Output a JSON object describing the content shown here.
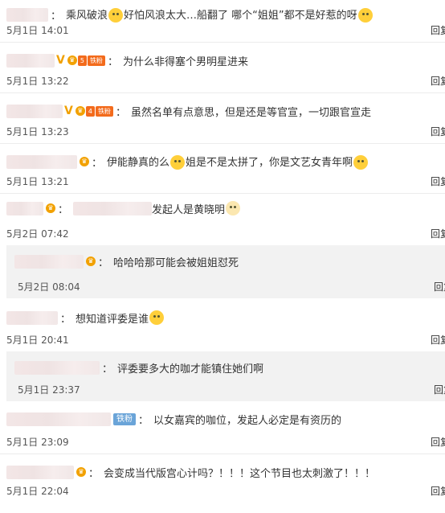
{
  "comments": [
    {
      "user_width": 52,
      "text_a": "乘风破浪",
      "text_b": "好怕风浪太大…船翻了 哪个“姐姐”都不是好惹的呀",
      "date": "5月1日 14:01",
      "reply": "回复"
    },
    {
      "user_width": 60,
      "badge_level": "5",
      "badge_fan": "铁粉",
      "text": "为什么非得塞个男明星进来",
      "date": "5月1日 13:22",
      "reply": "回复"
    },
    {
      "user_width": 70,
      "badge_level": "4",
      "badge_fan": "铁粉",
      "text": "虽然名单有点意思，但是还是等官宣，一切跟官宣走",
      "date": "5月1日 13:23",
      "reply": "回复"
    },
    {
      "user_width": 88,
      "text_a": "伊能静真的么",
      "text_b": "姐是不是太拼了，你是文艺女青年啊",
      "date": "5月1日 13:21",
      "reply": "回复"
    },
    {
      "user_width": 46,
      "text": "发起人是黄晓明",
      "date": "5月2日 07:42",
      "reply": "回复"
    },
    {
      "user_width": 86,
      "text": "哈哈哈那可能会被姐姐怼死",
      "date": "5月2日 08:04",
      "reply": "回复"
    },
    {
      "user_width": 64,
      "text": "想知道评委是谁",
      "date": "5月1日 20:41",
      "reply": "回复"
    },
    {
      "user_width": 106,
      "text": "评委要多大的咖才能镇住她们啊",
      "date": "5月1日 23:37",
      "reply": "回复"
    },
    {
      "user_width": 130,
      "badge_fan": "铁粉",
      "text": "以女嘉宾的咖位，发起人必定是有资历的",
      "date": "5月1日 23:09",
      "reply": "回复"
    },
    {
      "user_width": 84,
      "text": "会变成当代版宫心计吗？！！！这个节目也太刺激了！！！",
      "date": "5月1日 22:04",
      "reply": "回复"
    }
  ],
  "icons": {
    "colon": "："
  }
}
